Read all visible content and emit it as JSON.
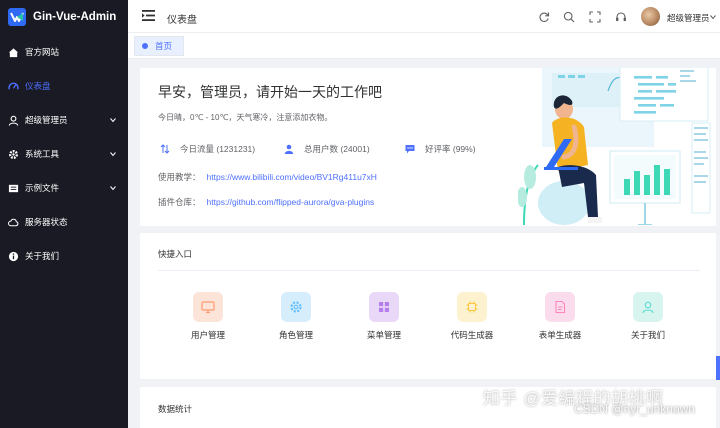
{
  "app": {
    "name": "Gin-Vue-Admin"
  },
  "sidebar": {
    "items": [
      {
        "label": "官方网站",
        "icon": "home-icon",
        "active": false,
        "expandable": false
      },
      {
        "label": "仪表盘",
        "icon": "speedometer-icon",
        "active": true,
        "expandable": false
      },
      {
        "label": "超级管理员",
        "icon": "user-icon",
        "active": false,
        "expandable": true
      },
      {
        "label": "系统工具",
        "icon": "gear-icon",
        "active": false,
        "expandable": true
      },
      {
        "label": "示例文件",
        "icon": "folder-icon",
        "active": false,
        "expandable": true
      },
      {
        "label": "服务器状态",
        "icon": "cloud-icon",
        "active": false,
        "expandable": false
      },
      {
        "label": "关于我们",
        "icon": "info-icon",
        "active": false,
        "expandable": false
      }
    ]
  },
  "header": {
    "title": "仪表盘",
    "icons": [
      "refresh-icon",
      "search-icon",
      "fullscreen-icon",
      "headset-icon"
    ],
    "user_name": "超级管理员"
  },
  "tabs": [
    {
      "label": "首页",
      "active": true
    }
  ],
  "welcome": {
    "greeting": "早安，管理员，请开始一天的工作吧",
    "weather": "今日晴，0℃ - 10℃，天气寒冷，注意添加衣物。",
    "stats": [
      {
        "label": "今日流量 (1231231)",
        "icon": "flow-icon"
      },
      {
        "label": "总用户数 (24001)",
        "icon": "users-icon"
      },
      {
        "label": "好评率 (99%)",
        "icon": "comment-icon"
      }
    ],
    "tutorial_label": "使用教学：",
    "tutorial_url": "https://www.bilibili.com/video/BV1Rg411u7xH",
    "plugin_label": "插件仓库：",
    "plugin_url": "https://github.com/flipped-aurora/gva-plugins"
  },
  "quick_entry": {
    "title": "快捷入口",
    "items": [
      {
        "label": "用户管理",
        "icon": "monitor-icon",
        "bg": "#fde4d9",
        "fg": "#ff9c6e"
      },
      {
        "label": "角色管理",
        "icon": "gear-icon",
        "bg": "#d6eefc",
        "fg": "#69c0ff"
      },
      {
        "label": "菜单管理",
        "icon": "grid-icon",
        "bg": "#ead8f9",
        "fg": "#b37feb"
      },
      {
        "label": "代码生成器",
        "icon": "cpu-icon",
        "bg": "#fdf2cf",
        "fg": "#ffd666"
      },
      {
        "label": "表单生成器",
        "icon": "document-icon",
        "bg": "#fbdcec",
        "fg": "#ff85c0"
      },
      {
        "label": "关于我们",
        "icon": "user-icon",
        "bg": "#d7f5ee",
        "fg": "#5cdbd3"
      }
    ]
  },
  "data_stats": {
    "title": "数据统计"
  },
  "colors": {
    "accent": "#4d70ff",
    "sidebar_bg": "#191a23"
  },
  "watermark": {
    "main": "知乎 @爱编程的胡桃啊",
    "sub": "CSDN @nyr_unknown"
  }
}
